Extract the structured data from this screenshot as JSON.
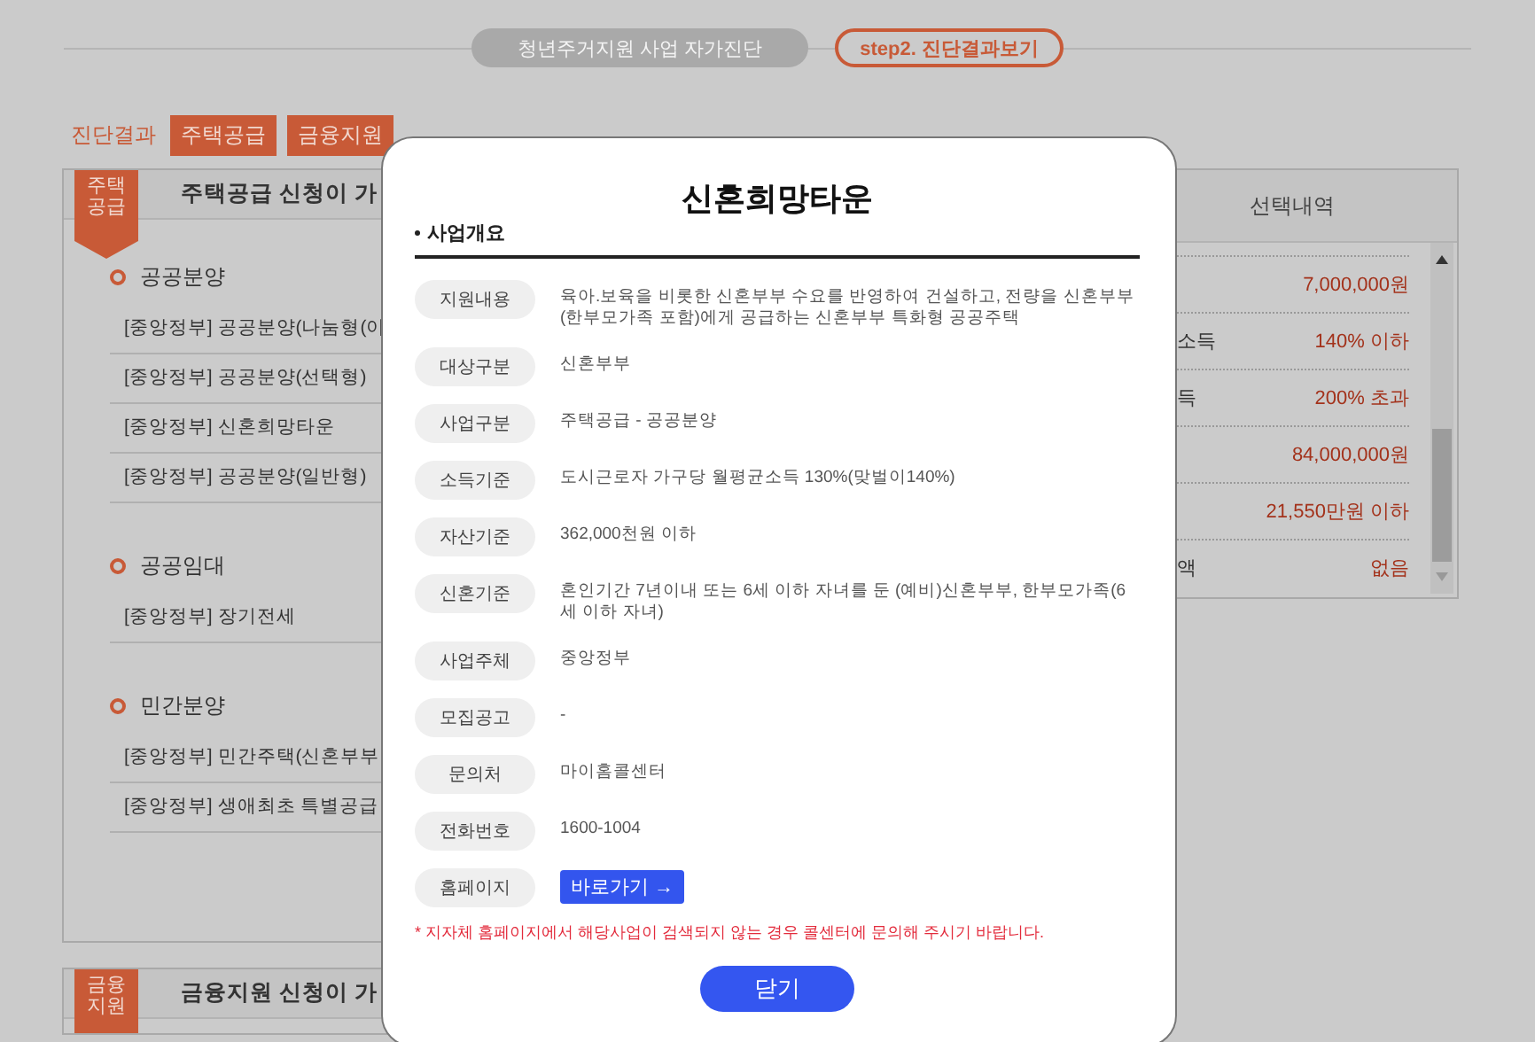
{
  "steps": [
    {
      "label": "청년주거지원 사업 자가진단",
      "selected": false
    },
    {
      "label": "step2. 진단결과보기",
      "selected": true
    }
  ],
  "result_bar": {
    "label": "진단결과",
    "tabs": [
      "주택공급",
      "금융지원"
    ]
  },
  "panels": [
    {
      "badge": "주택공급",
      "title": "주택공급 신청이 가",
      "groups": [
        {
          "heading": "공공분양",
          "items": [
            "[중앙정부] 공공분양(나눔형(이",
            "[중앙정부] 공공분양(선택형)",
            "[중앙정부] 신혼희망타운",
            "[중앙정부] 공공분양(일반형)"
          ]
        },
        {
          "heading": "공공임대",
          "items": [
            "[중앙정부] 장기전세"
          ]
        },
        {
          "heading": "민간분양",
          "items": [
            "[중앙정부] 민간주택(신혼부부",
            "[중앙정부] 생애최초 특별공급"
          ]
        }
      ]
    },
    {
      "badge": "금융지원",
      "title": "금융지원 신청이 가"
    }
  ],
  "selection": {
    "header": "선택내역",
    "rows": [
      {
        "value": "7,000,000원"
      },
      {
        "label": "소득",
        "value": "140% 이하"
      },
      {
        "label": "득",
        "value": "200% 초과"
      },
      {
        "value": "84,000,000원"
      },
      {
        "value": "21,550만원 이하"
      },
      {
        "label": "액",
        "value": "없음"
      }
    ]
  },
  "modal": {
    "title": "신혼희망타운",
    "section": "사업개요",
    "fields": [
      {
        "label": "지원내용",
        "kind": "text",
        "value": "육아.보육을 비롯한 신혼부부 수요를 반영하여 건설하고, 전량을 신혼부부(한부모가족 포함)에게 공급하는 신혼부부 특화형 공공주택"
      },
      {
        "label": "대상구분",
        "kind": "text",
        "value": "신혼부부"
      },
      {
        "label": "사업구분",
        "kind": "text",
        "value": "주택공급 - 공공분양"
      },
      {
        "label": "소득기준",
        "kind": "text",
        "value": "도시근로자 가구당 월평균소득 130%(맞벌이140%)"
      },
      {
        "label": "자산기준",
        "kind": "text",
        "value": "362,000천원 이하"
      },
      {
        "label": "신혼기준",
        "kind": "text",
        "value": "혼인기간 7년이내 또는 6세 이하 자녀를 둔 (예비)신혼부부, 한부모가족(6세 이하 자녀)"
      },
      {
        "label": "사업주체",
        "kind": "text",
        "value": "중앙정부"
      },
      {
        "label": "모집공고",
        "kind": "text",
        "value": "-"
      },
      {
        "label": "문의처",
        "kind": "text",
        "value": "마이홈콜센터"
      },
      {
        "label": "전화번호",
        "kind": "text",
        "value": "1600-1004"
      },
      {
        "label": "홈페이지",
        "kind": "link",
        "value": "바로가기 →"
      }
    ],
    "note": "* 지자체 홈페이지에서 해당사업이 검색되지 않는 경우 콜센터에 문의해 주시기 바랍니다.",
    "close": "닫기"
  }
}
